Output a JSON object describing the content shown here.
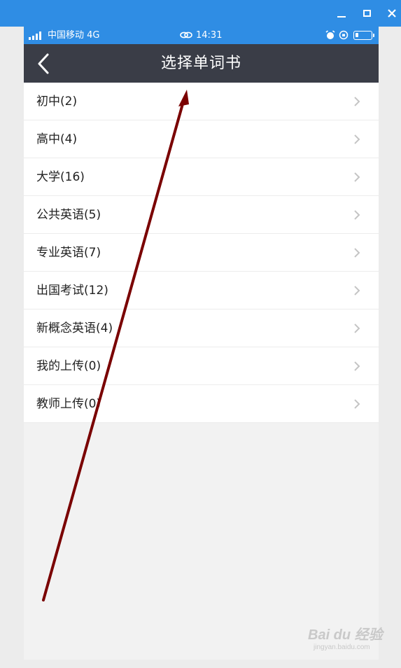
{
  "window": {
    "controls": [
      "minimize",
      "maximize",
      "close"
    ],
    "accent": "#2f8de4"
  },
  "statusbar": {
    "carrier": "中国移动 4G",
    "time": "14:31",
    "icons": [
      "signal-icon",
      "link-icon",
      "alarm-icon",
      "rotation-lock-icon",
      "battery-icon"
    ]
  },
  "navbar": {
    "title": "选择单词书",
    "back_icon": "chevron-left-icon",
    "background": "#3a3d47"
  },
  "list": {
    "items": [
      {
        "label": "初中(2)"
      },
      {
        "label": "高中(4)"
      },
      {
        "label": "大学(16)"
      },
      {
        "label": "公共英语(5)"
      },
      {
        "label": "专业英语(7)"
      },
      {
        "label": "出国考试(12)"
      },
      {
        "label": "新概念英语(4)"
      },
      {
        "label": "我的上传(0)"
      },
      {
        "label": "教师上传(0)"
      }
    ],
    "row_icon": "chevron-right-icon"
  },
  "annotation": {
    "type": "arrow",
    "color": "#7a0000"
  },
  "watermark": {
    "main": "Bai du 经验",
    "sub": "jingyan.baidu.com"
  }
}
